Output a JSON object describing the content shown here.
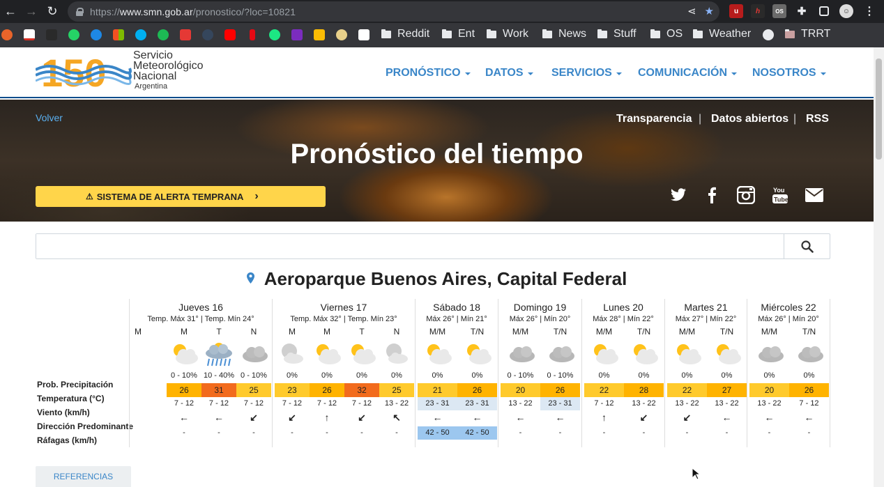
{
  "browser": {
    "url_prefix": "https://",
    "url_domain": "www.smn.gob.ar",
    "url_path": "/pronostico/?loc=10821",
    "bookmarks": [
      "Reddit",
      "Ent",
      "Work",
      "News",
      "Stuff",
      "OS",
      "Weather",
      "TRRT"
    ]
  },
  "site": {
    "logo_line1": "Servicio",
    "logo_line2": "Meteorológico",
    "logo_line3": "Nacional",
    "logo_line4": "Argentina",
    "logo_number": "150",
    "nav": [
      "PRONÓSTICO",
      "DATOS",
      "SERVICIOS",
      "COMUNICACIÓN",
      "NOSOTROS"
    ]
  },
  "hero": {
    "back": "Volver",
    "links": [
      "Transparencia",
      "Datos abiertos",
      "RSS"
    ],
    "separator": "|",
    "title": "Pronóstico del tiempo",
    "alert_button": "SISTEMA DE ALERTA TEMPRANA"
  },
  "search": {
    "placeholder": ""
  },
  "location": "Aeroparque Buenos Aires, Capital Federal",
  "row_labels": [
    "Prob. Precipitación",
    "Temperatura (°C)",
    "Viento (km/h)",
    "Dirección Predominante",
    "Ráfagas (km/h)"
  ],
  "days": [
    {
      "name": "Jueves 16",
      "sub": "Temp. Máx 31° | Temp. Mín 24°",
      "periods": [
        {
          "label": "M",
          "icon": "none",
          "precip": "",
          "temp": "",
          "wind": "",
          "dir": "",
          "gust": ""
        },
        {
          "label": "M",
          "icon": "sun-cloud",
          "precip": "0 - 10%",
          "temp": "26",
          "wind": "7 - 12",
          "dir": "←",
          "gust": "-"
        },
        {
          "label": "T",
          "icon": "storm-rain",
          "precip": "10 - 40%",
          "temp": "31",
          "wind": "7 - 12",
          "dir": "←",
          "gust": "-"
        },
        {
          "label": "N",
          "icon": "cloud",
          "precip": "0 - 10%",
          "temp": "25",
          "wind": "7 - 12",
          "dir": "↙",
          "gust": "-"
        }
      ]
    },
    {
      "name": "Viernes 17",
      "sub": "Temp. Máx 32° | Temp. Mín 23°",
      "periods": [
        {
          "label": "M",
          "icon": "moon-cloud",
          "precip": "0%",
          "temp": "23",
          "wind": "7 - 12",
          "dir": "↙",
          "gust": "-"
        },
        {
          "label": "M",
          "icon": "sun-cloud",
          "precip": "0%",
          "temp": "26",
          "wind": "7 - 12",
          "dir": "↑",
          "gust": "-"
        },
        {
          "label": "T",
          "icon": "sun-cloud",
          "precip": "0%",
          "temp": "32",
          "wind": "7 - 12",
          "dir": "↙",
          "gust": "-"
        },
        {
          "label": "N",
          "icon": "moon-cloud",
          "precip": "0%",
          "temp": "25",
          "wind": "13 - 22",
          "dir": "↖",
          "gust": "-"
        }
      ]
    },
    {
      "name": "Sábado 18",
      "sub": "Máx 26° | Mín 21°",
      "periods": [
        {
          "label": "M/M",
          "icon": "sun-cloud",
          "precip": "0%",
          "temp": "21",
          "wind": "23 - 31",
          "dir": "←",
          "gust": "42 - 50"
        },
        {
          "label": "T/N",
          "icon": "sun-cloud",
          "precip": "0%",
          "temp": "26",
          "wind": "23 - 31",
          "dir": "←",
          "gust": "42 - 50"
        }
      ]
    },
    {
      "name": "Domingo 19",
      "sub": "Máx 26° | Mín 20°",
      "periods": [
        {
          "label": "M/M",
          "icon": "cloud",
          "precip": "0 - 10%",
          "temp": "20",
          "wind": "13 - 22",
          "dir": "←",
          "gust": "-"
        },
        {
          "label": "T/N",
          "icon": "cloud",
          "precip": "0 - 10%",
          "temp": "26",
          "wind": "23 - 31",
          "dir": "←",
          "gust": "-"
        }
      ]
    },
    {
      "name": "Lunes 20",
      "sub": "Máx 28° | Mín 22°",
      "periods": [
        {
          "label": "M/M",
          "icon": "sun-cloud",
          "precip": "0%",
          "temp": "22",
          "wind": "7 - 12",
          "dir": "↑",
          "gust": "-"
        },
        {
          "label": "T/N",
          "icon": "sun-cloud",
          "precip": "0%",
          "temp": "28",
          "wind": "13 - 22",
          "dir": "↙",
          "gust": "-"
        }
      ]
    },
    {
      "name": "Martes 21",
      "sub": "Máx 27° | Mín 22°",
      "periods": [
        {
          "label": "M/M",
          "icon": "sun-cloud",
          "precip": "0%",
          "temp": "22",
          "wind": "13 - 22",
          "dir": "↙",
          "gust": "-"
        },
        {
          "label": "T/N",
          "icon": "sun-cloud",
          "precip": "0%",
          "temp": "27",
          "wind": "13 - 22",
          "dir": "←",
          "gust": "-"
        }
      ]
    },
    {
      "name": "Miércoles 22",
      "sub": "Máx 26° | Mín 20°",
      "periods": [
        {
          "label": "M/M",
          "icon": "cloud",
          "precip": "0%",
          "temp": "20",
          "wind": "13 - 22",
          "dir": "←",
          "gust": "-"
        },
        {
          "label": "T/N",
          "icon": "cloud",
          "precip": "0%",
          "temp": "26",
          "wind": "7 - 12",
          "dir": "←",
          "gust": "-"
        }
      ]
    }
  ],
  "references_button": "REFERENCIAS",
  "colors": {
    "temp_20_25": "#ffca2c",
    "temp_26_30": "#ffb300",
    "temp_31_plus": "#f26b1d",
    "wind_high": "#dce8f3",
    "gust_high": "#9cc7ef",
    "nav_blue": "#3a86c8",
    "alert_yellow": "#ffd54a"
  }
}
